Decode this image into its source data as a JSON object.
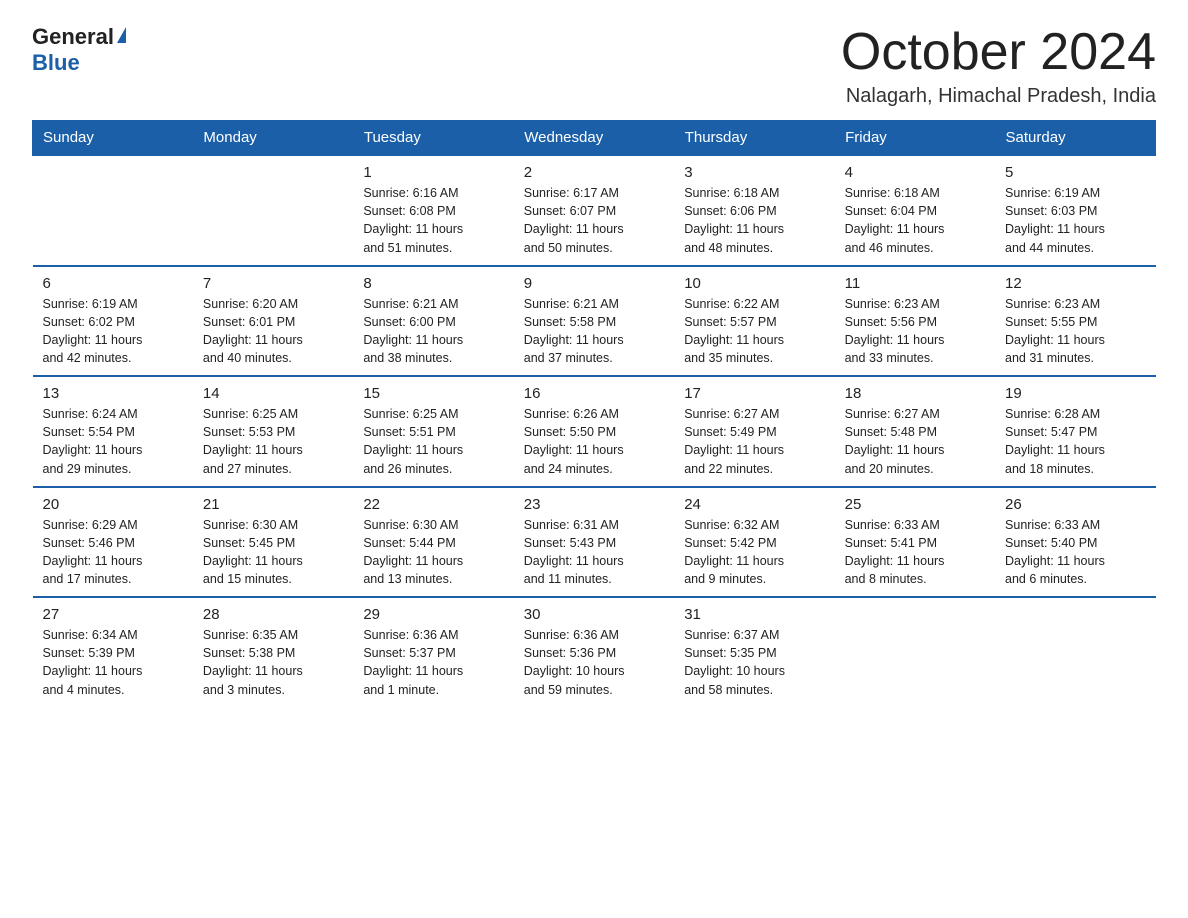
{
  "logo": {
    "general": "General",
    "blue": "Blue"
  },
  "title": "October 2024",
  "location": "Nalagarh, Himachal Pradesh, India",
  "weekdays": [
    "Sunday",
    "Monday",
    "Tuesday",
    "Wednesday",
    "Thursday",
    "Friday",
    "Saturday"
  ],
  "weeks": [
    [
      {
        "day": "",
        "info": ""
      },
      {
        "day": "",
        "info": ""
      },
      {
        "day": "1",
        "info": "Sunrise: 6:16 AM\nSunset: 6:08 PM\nDaylight: 11 hours\nand 51 minutes."
      },
      {
        "day": "2",
        "info": "Sunrise: 6:17 AM\nSunset: 6:07 PM\nDaylight: 11 hours\nand 50 minutes."
      },
      {
        "day": "3",
        "info": "Sunrise: 6:18 AM\nSunset: 6:06 PM\nDaylight: 11 hours\nand 48 minutes."
      },
      {
        "day": "4",
        "info": "Sunrise: 6:18 AM\nSunset: 6:04 PM\nDaylight: 11 hours\nand 46 minutes."
      },
      {
        "day": "5",
        "info": "Sunrise: 6:19 AM\nSunset: 6:03 PM\nDaylight: 11 hours\nand 44 minutes."
      }
    ],
    [
      {
        "day": "6",
        "info": "Sunrise: 6:19 AM\nSunset: 6:02 PM\nDaylight: 11 hours\nand 42 minutes."
      },
      {
        "day": "7",
        "info": "Sunrise: 6:20 AM\nSunset: 6:01 PM\nDaylight: 11 hours\nand 40 minutes."
      },
      {
        "day": "8",
        "info": "Sunrise: 6:21 AM\nSunset: 6:00 PM\nDaylight: 11 hours\nand 38 minutes."
      },
      {
        "day": "9",
        "info": "Sunrise: 6:21 AM\nSunset: 5:58 PM\nDaylight: 11 hours\nand 37 minutes."
      },
      {
        "day": "10",
        "info": "Sunrise: 6:22 AM\nSunset: 5:57 PM\nDaylight: 11 hours\nand 35 minutes."
      },
      {
        "day": "11",
        "info": "Sunrise: 6:23 AM\nSunset: 5:56 PM\nDaylight: 11 hours\nand 33 minutes."
      },
      {
        "day": "12",
        "info": "Sunrise: 6:23 AM\nSunset: 5:55 PM\nDaylight: 11 hours\nand 31 minutes."
      }
    ],
    [
      {
        "day": "13",
        "info": "Sunrise: 6:24 AM\nSunset: 5:54 PM\nDaylight: 11 hours\nand 29 minutes."
      },
      {
        "day": "14",
        "info": "Sunrise: 6:25 AM\nSunset: 5:53 PM\nDaylight: 11 hours\nand 27 minutes."
      },
      {
        "day": "15",
        "info": "Sunrise: 6:25 AM\nSunset: 5:51 PM\nDaylight: 11 hours\nand 26 minutes."
      },
      {
        "day": "16",
        "info": "Sunrise: 6:26 AM\nSunset: 5:50 PM\nDaylight: 11 hours\nand 24 minutes."
      },
      {
        "day": "17",
        "info": "Sunrise: 6:27 AM\nSunset: 5:49 PM\nDaylight: 11 hours\nand 22 minutes."
      },
      {
        "day": "18",
        "info": "Sunrise: 6:27 AM\nSunset: 5:48 PM\nDaylight: 11 hours\nand 20 minutes."
      },
      {
        "day": "19",
        "info": "Sunrise: 6:28 AM\nSunset: 5:47 PM\nDaylight: 11 hours\nand 18 minutes."
      }
    ],
    [
      {
        "day": "20",
        "info": "Sunrise: 6:29 AM\nSunset: 5:46 PM\nDaylight: 11 hours\nand 17 minutes."
      },
      {
        "day": "21",
        "info": "Sunrise: 6:30 AM\nSunset: 5:45 PM\nDaylight: 11 hours\nand 15 minutes."
      },
      {
        "day": "22",
        "info": "Sunrise: 6:30 AM\nSunset: 5:44 PM\nDaylight: 11 hours\nand 13 minutes."
      },
      {
        "day": "23",
        "info": "Sunrise: 6:31 AM\nSunset: 5:43 PM\nDaylight: 11 hours\nand 11 minutes."
      },
      {
        "day": "24",
        "info": "Sunrise: 6:32 AM\nSunset: 5:42 PM\nDaylight: 11 hours\nand 9 minutes."
      },
      {
        "day": "25",
        "info": "Sunrise: 6:33 AM\nSunset: 5:41 PM\nDaylight: 11 hours\nand 8 minutes."
      },
      {
        "day": "26",
        "info": "Sunrise: 6:33 AM\nSunset: 5:40 PM\nDaylight: 11 hours\nand 6 minutes."
      }
    ],
    [
      {
        "day": "27",
        "info": "Sunrise: 6:34 AM\nSunset: 5:39 PM\nDaylight: 11 hours\nand 4 minutes."
      },
      {
        "day": "28",
        "info": "Sunrise: 6:35 AM\nSunset: 5:38 PM\nDaylight: 11 hours\nand 3 minutes."
      },
      {
        "day": "29",
        "info": "Sunrise: 6:36 AM\nSunset: 5:37 PM\nDaylight: 11 hours\nand 1 minute."
      },
      {
        "day": "30",
        "info": "Sunrise: 6:36 AM\nSunset: 5:36 PM\nDaylight: 10 hours\nand 59 minutes."
      },
      {
        "day": "31",
        "info": "Sunrise: 6:37 AM\nSunset: 5:35 PM\nDaylight: 10 hours\nand 58 minutes."
      },
      {
        "day": "",
        "info": ""
      },
      {
        "day": "",
        "info": ""
      }
    ]
  ]
}
